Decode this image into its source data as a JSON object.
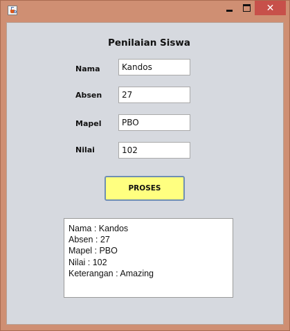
{
  "window": {
    "close_glyph": "✕",
    "frame_color": "#cf8f73",
    "close_color": "#c7504a"
  },
  "form": {
    "title": "Penilaian Siswa",
    "fields": [
      {
        "label": "Nama",
        "value": "Kandos"
      },
      {
        "label": "Absen",
        "value": "27"
      },
      {
        "label": "Mapel",
        "value": "PBO"
      },
      {
        "label": "Nilai",
        "value": "102"
      }
    ],
    "button_label": "PROSES",
    "button_color": "#ffff80"
  },
  "output": {
    "lines": [
      "Nama : Kandos",
      "Absen : 27",
      "Mapel : PBO",
      "Nilai : 102",
      "Keterangan : Amazing"
    ]
  }
}
